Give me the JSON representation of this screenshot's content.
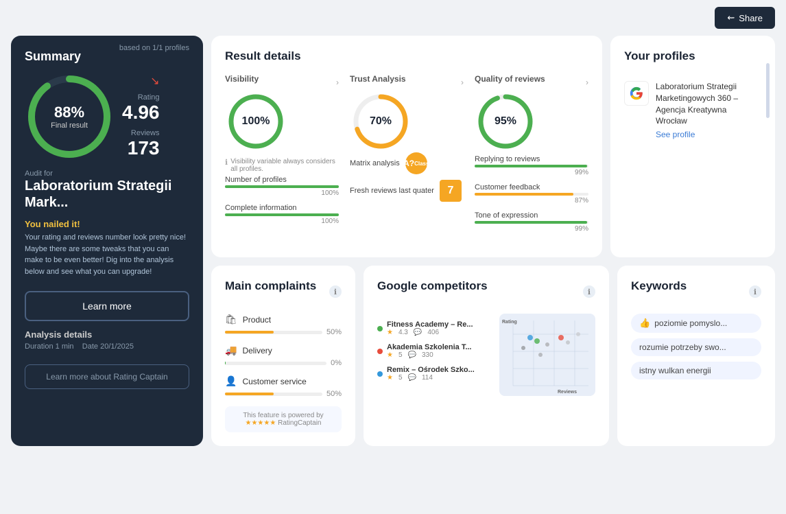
{
  "topbar": {
    "share_label": "Share"
  },
  "summary": {
    "title": "Summary",
    "based_on": "based on 1/1 profiles",
    "final_pct": "88%",
    "final_label": "Final result",
    "rating_label": "Rating",
    "rating_value": "4.96",
    "reviews_label": "Reviews",
    "reviews_value": "173",
    "audit_for": "Audit for",
    "audit_name": "Laboratorium Strategii Mark...",
    "you_nailed_title": "You nailed it!",
    "you_nailed_text": "Your rating and reviews number look pretty nice! Maybe there are some tweaks that you can make to be even better! Dig into the analysis below and see what you can upgrade!",
    "learn_more_label": "Learn more",
    "analysis_title": "Analysis details",
    "duration_label": "Duration",
    "duration_value": "1 min",
    "date_label": "Date",
    "date_value": "20/1/2025",
    "learn_more_rc_label": "Learn more about Rating Captain"
  },
  "result_details": {
    "title": "Result details",
    "visibility": {
      "title": "Visibility",
      "pct": "100%",
      "pct_num": 100,
      "color": "#4caf50",
      "info": "Visibility variable always considers all profiles.",
      "rows": [
        {
          "label": "Number of profiles",
          "pct": 100,
          "color": "#4caf50",
          "pct_label": "100%"
        },
        {
          "label": "Complete information",
          "pct": 100,
          "color": "#4caf50",
          "pct_label": "100%"
        }
      ]
    },
    "trust": {
      "title": "Trust Analysis",
      "pct": "70%",
      "pct_num": 70,
      "color": "#f5a623",
      "matrix_label": "Matrix analysis",
      "matrix_class": "A? Class",
      "fresh_label": "Fresh reviews last quater",
      "fresh_value": "7"
    },
    "quality": {
      "title": "Quality of reviews",
      "pct": "95%",
      "pct_num": 95,
      "color": "#4caf50",
      "rows": [
        {
          "label": "Replying to reviews",
          "pct": 99,
          "color": "#4caf50",
          "pct_label": "99%"
        },
        {
          "label": "Customer feedback",
          "pct": 87,
          "color": "#f5a623",
          "pct_label": "87%"
        },
        {
          "label": "Tone of expression",
          "pct": 99,
          "color": "#4caf50",
          "pct_label": "99%"
        }
      ]
    }
  },
  "profiles": {
    "title": "Your profiles",
    "items": [
      {
        "name": "Laboratorium Strategii Marketingowych 360 – Agencja Kreatywna Wrocław",
        "see_profile": "See profile"
      }
    ]
  },
  "complaints": {
    "title": "Main complaints",
    "items": [
      {
        "icon": "🛍",
        "label": "Product",
        "pct": 50,
        "color": "#f5a623",
        "pct_label": "50%"
      },
      {
        "icon": "🚚",
        "label": "Delivery",
        "pct": 0,
        "color": "#4caf50",
        "pct_label": "0%"
      },
      {
        "icon": "👤",
        "label": "Customer service",
        "pct": 50,
        "color": "#f5a623",
        "pct_label": "50%"
      }
    ],
    "powered_by": "This feature is powered by",
    "powered_stars": "★★★★★",
    "powered_name": "RatingCaptain"
  },
  "competitors": {
    "title": "Google competitors",
    "items": [
      {
        "dot_color": "#4caf50",
        "name": "Fitness Academy – Re...",
        "rating": "4.3",
        "reviews": "406"
      },
      {
        "dot_color": "#e74c3c",
        "name": "Akademia Szkolenia T...",
        "rating": "5",
        "reviews": "330"
      },
      {
        "dot_color": "#3498db",
        "name": "Remix – Ośrodek Szko...",
        "rating": "5",
        "reviews": "114"
      }
    ],
    "chart": {
      "x_label": "Reviews",
      "y_label": "Rating"
    }
  },
  "keywords": {
    "title": "Keywords",
    "items": [
      {
        "label": "poziomie pomyslo...",
        "has_thumb": true
      },
      {
        "label": "rozumie potrzeby swo...",
        "has_thumb": false
      },
      {
        "label": "istny wulkan energii",
        "has_thumb": false
      }
    ]
  }
}
